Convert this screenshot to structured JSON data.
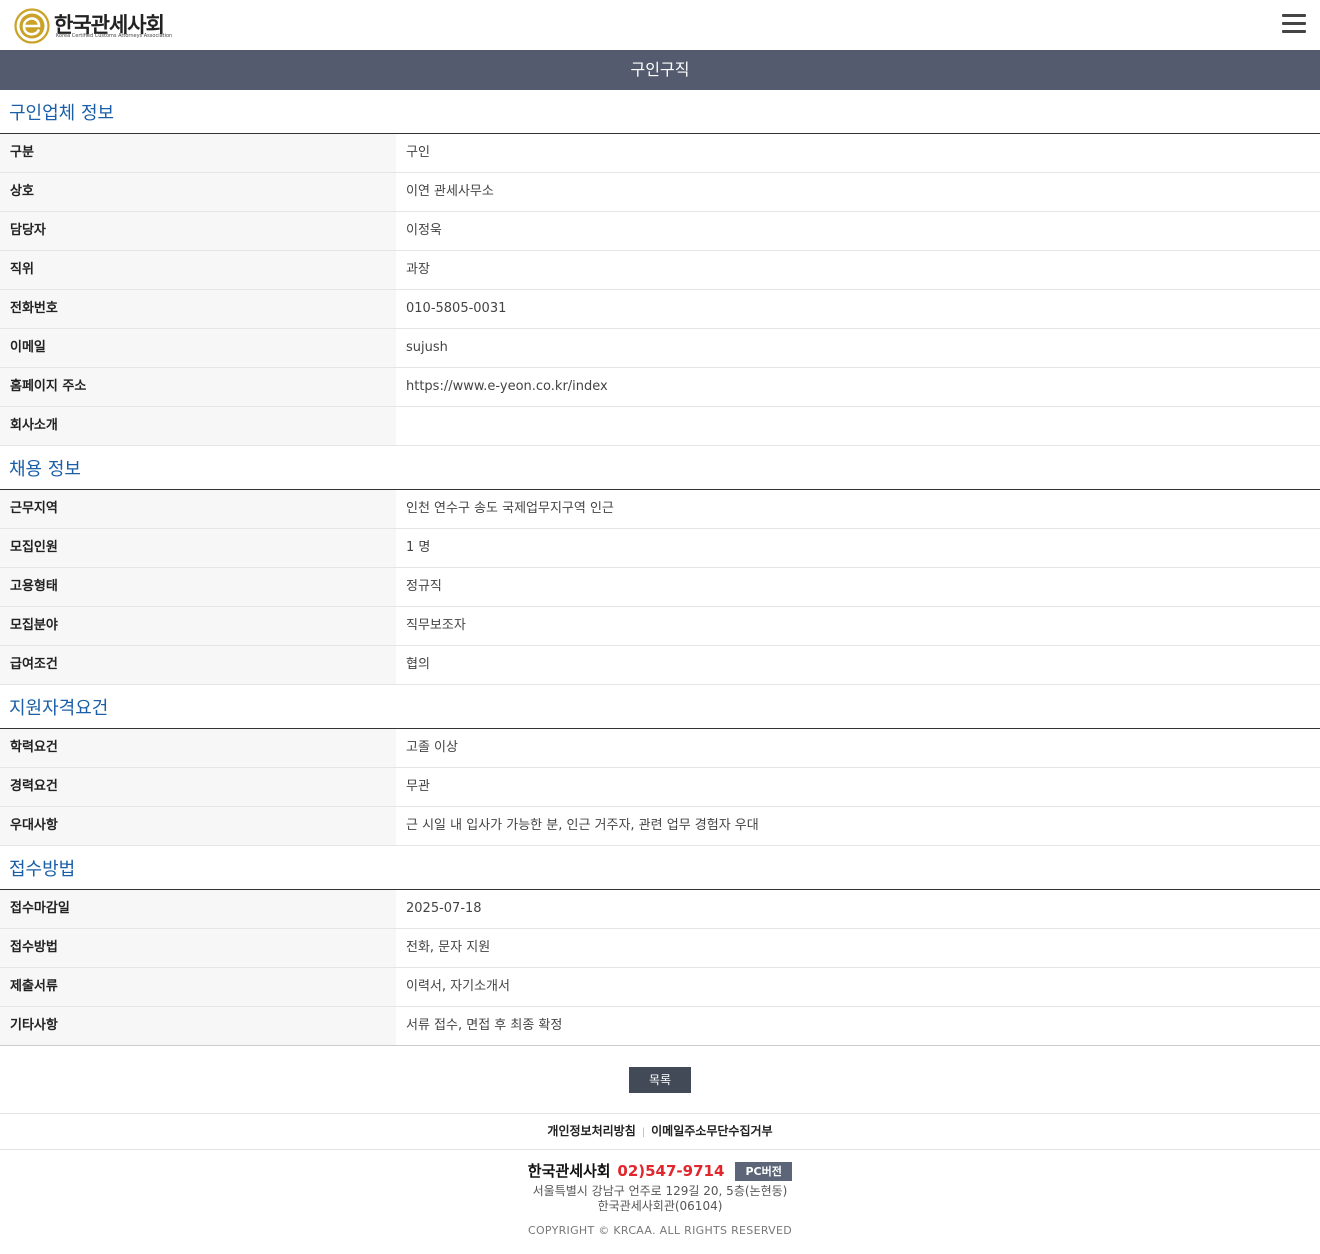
{
  "header": {
    "logo_text": "한국관세사회",
    "logo_subtext": "Korea Certified Customs Attorneys Association"
  },
  "page_title": "구인구직",
  "sections": [
    {
      "title": "구인업체 정보",
      "rows": [
        {
          "label": "구분",
          "value": "구인"
        },
        {
          "label": "상호",
          "value": "이연 관세사무소"
        },
        {
          "label": "담당자",
          "value": "이정욱"
        },
        {
          "label": "직위",
          "value": "과장"
        },
        {
          "label": "전화번호",
          "value": "010-5805-0031"
        },
        {
          "label": "이메일",
          "value": "sujush"
        },
        {
          "label": "홈페이지 주소",
          "value": "https://www.e-yeon.co.kr/index"
        },
        {
          "label": "회사소개",
          "value": ""
        }
      ]
    },
    {
      "title": "채용 정보",
      "rows": [
        {
          "label": "근무지역",
          "value": "인천 연수구 송도 국제업무지구역 인근"
        },
        {
          "label": "모집인원",
          "value": "1 명"
        },
        {
          "label": "고용형태",
          "value": "정규직"
        },
        {
          "label": "모집분야",
          "value": "직무보조자"
        },
        {
          "label": "급여조건",
          "value": "협의"
        }
      ]
    },
    {
      "title": "지원자격요건",
      "rows": [
        {
          "label": "학력요건",
          "value": "고졸 이상"
        },
        {
          "label": "경력요건",
          "value": "무관"
        },
        {
          "label": "우대사항",
          "value": "근 시일 내 입사가 가능한 분, 인근 거주자, 관련 업무 경험자 우대"
        }
      ]
    },
    {
      "title": "접수방법",
      "rows": [
        {
          "label": "접수마감일",
          "value": "2025-07-18"
        },
        {
          "label": "접수방법",
          "value": "전화, 문자 지원"
        },
        {
          "label": "제출서류",
          "value": "이력서, 자기소개서"
        },
        {
          "label": "기타사항",
          "value": "서류 접수, 면접 후 최종 확정"
        }
      ]
    }
  ],
  "list_button_label": "목록",
  "footer": {
    "links": [
      "개인정보처리방침",
      "이메일주소무단수집거부"
    ],
    "org_name": "한국관세사회",
    "phone": "02)547-9714",
    "pc_version_label": "PC버전",
    "address_line1": "서울특별시 강남구 언주로 129길 20, 5층(논현동)",
    "address_line2": "한국관세사회관(06104)",
    "copyright": "COPYRIGHT © KRCAA. ALL RIGHTS RESERVED"
  },
  "colors": {
    "title_bar": "#555b6e",
    "section_title": "#1a5fa8",
    "phone": "#e1262d",
    "logo_gold": "#c9a227"
  },
  "icons": {
    "logo": "krcaa-logo-icon",
    "menu": "hamburger-menu-icon"
  }
}
